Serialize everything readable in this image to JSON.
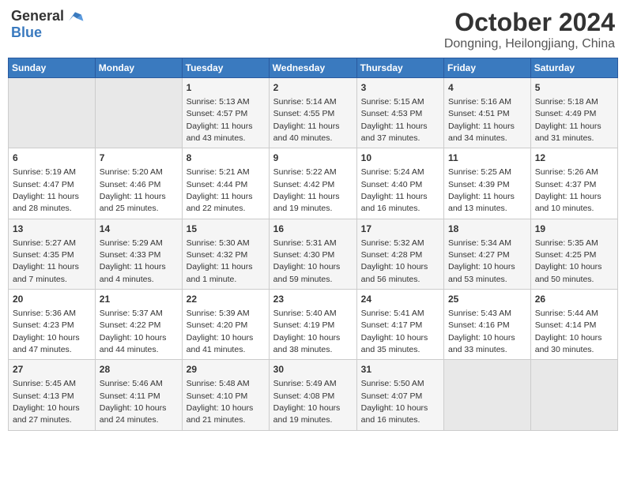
{
  "header": {
    "logo_general": "General",
    "logo_blue": "Blue",
    "title": "October 2024",
    "location": "Dongning, Heilongjiang, China"
  },
  "days_of_week": [
    "Sunday",
    "Monday",
    "Tuesday",
    "Wednesday",
    "Thursday",
    "Friday",
    "Saturday"
  ],
  "weeks": [
    [
      {
        "day": "",
        "info": ""
      },
      {
        "day": "",
        "info": ""
      },
      {
        "day": "1",
        "info": "Sunrise: 5:13 AM\nSunset: 4:57 PM\nDaylight: 11 hours and 43 minutes."
      },
      {
        "day": "2",
        "info": "Sunrise: 5:14 AM\nSunset: 4:55 PM\nDaylight: 11 hours and 40 minutes."
      },
      {
        "day": "3",
        "info": "Sunrise: 5:15 AM\nSunset: 4:53 PM\nDaylight: 11 hours and 37 minutes."
      },
      {
        "day": "4",
        "info": "Sunrise: 5:16 AM\nSunset: 4:51 PM\nDaylight: 11 hours and 34 minutes."
      },
      {
        "day": "5",
        "info": "Sunrise: 5:18 AM\nSunset: 4:49 PM\nDaylight: 11 hours and 31 minutes."
      }
    ],
    [
      {
        "day": "6",
        "info": "Sunrise: 5:19 AM\nSunset: 4:47 PM\nDaylight: 11 hours and 28 minutes."
      },
      {
        "day": "7",
        "info": "Sunrise: 5:20 AM\nSunset: 4:46 PM\nDaylight: 11 hours and 25 minutes."
      },
      {
        "day": "8",
        "info": "Sunrise: 5:21 AM\nSunset: 4:44 PM\nDaylight: 11 hours and 22 minutes."
      },
      {
        "day": "9",
        "info": "Sunrise: 5:22 AM\nSunset: 4:42 PM\nDaylight: 11 hours and 19 minutes."
      },
      {
        "day": "10",
        "info": "Sunrise: 5:24 AM\nSunset: 4:40 PM\nDaylight: 11 hours and 16 minutes."
      },
      {
        "day": "11",
        "info": "Sunrise: 5:25 AM\nSunset: 4:39 PM\nDaylight: 11 hours and 13 minutes."
      },
      {
        "day": "12",
        "info": "Sunrise: 5:26 AM\nSunset: 4:37 PM\nDaylight: 11 hours and 10 minutes."
      }
    ],
    [
      {
        "day": "13",
        "info": "Sunrise: 5:27 AM\nSunset: 4:35 PM\nDaylight: 11 hours and 7 minutes."
      },
      {
        "day": "14",
        "info": "Sunrise: 5:29 AM\nSunset: 4:33 PM\nDaylight: 11 hours and 4 minutes."
      },
      {
        "day": "15",
        "info": "Sunrise: 5:30 AM\nSunset: 4:32 PM\nDaylight: 11 hours and 1 minute."
      },
      {
        "day": "16",
        "info": "Sunrise: 5:31 AM\nSunset: 4:30 PM\nDaylight: 10 hours and 59 minutes."
      },
      {
        "day": "17",
        "info": "Sunrise: 5:32 AM\nSunset: 4:28 PM\nDaylight: 10 hours and 56 minutes."
      },
      {
        "day": "18",
        "info": "Sunrise: 5:34 AM\nSunset: 4:27 PM\nDaylight: 10 hours and 53 minutes."
      },
      {
        "day": "19",
        "info": "Sunrise: 5:35 AM\nSunset: 4:25 PM\nDaylight: 10 hours and 50 minutes."
      }
    ],
    [
      {
        "day": "20",
        "info": "Sunrise: 5:36 AM\nSunset: 4:23 PM\nDaylight: 10 hours and 47 minutes."
      },
      {
        "day": "21",
        "info": "Sunrise: 5:37 AM\nSunset: 4:22 PM\nDaylight: 10 hours and 44 minutes."
      },
      {
        "day": "22",
        "info": "Sunrise: 5:39 AM\nSunset: 4:20 PM\nDaylight: 10 hours and 41 minutes."
      },
      {
        "day": "23",
        "info": "Sunrise: 5:40 AM\nSunset: 4:19 PM\nDaylight: 10 hours and 38 minutes."
      },
      {
        "day": "24",
        "info": "Sunrise: 5:41 AM\nSunset: 4:17 PM\nDaylight: 10 hours and 35 minutes."
      },
      {
        "day": "25",
        "info": "Sunrise: 5:43 AM\nSunset: 4:16 PM\nDaylight: 10 hours and 33 minutes."
      },
      {
        "day": "26",
        "info": "Sunrise: 5:44 AM\nSunset: 4:14 PM\nDaylight: 10 hours and 30 minutes."
      }
    ],
    [
      {
        "day": "27",
        "info": "Sunrise: 5:45 AM\nSunset: 4:13 PM\nDaylight: 10 hours and 27 minutes."
      },
      {
        "day": "28",
        "info": "Sunrise: 5:46 AM\nSunset: 4:11 PM\nDaylight: 10 hours and 24 minutes."
      },
      {
        "day": "29",
        "info": "Sunrise: 5:48 AM\nSunset: 4:10 PM\nDaylight: 10 hours and 21 minutes."
      },
      {
        "day": "30",
        "info": "Sunrise: 5:49 AM\nSunset: 4:08 PM\nDaylight: 10 hours and 19 minutes."
      },
      {
        "day": "31",
        "info": "Sunrise: 5:50 AM\nSunset: 4:07 PM\nDaylight: 10 hours and 16 minutes."
      },
      {
        "day": "",
        "info": ""
      },
      {
        "day": "",
        "info": ""
      }
    ]
  ]
}
